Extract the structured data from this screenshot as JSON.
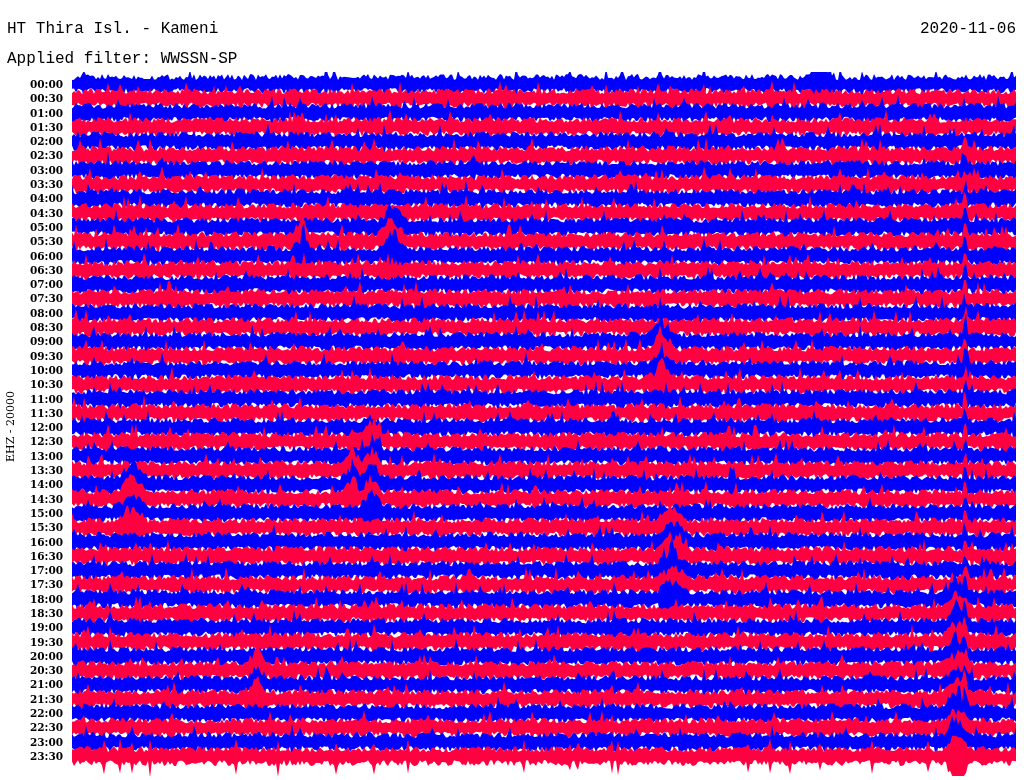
{
  "header": {
    "station": "HT Thira Isl. - Kameni",
    "date": "2020-11-06",
    "filter": "Applied filter: WWSSN-SP"
  },
  "axis_label": "EHZ - 20000",
  "rows": [
    {
      "time": "00:00",
      "color": "#0000ff"
    },
    {
      "time": "00:30",
      "color": "#ff0040"
    },
    {
      "time": "01:00",
      "color": "#0000ff"
    },
    {
      "time": "01:30",
      "color": "#ff0040"
    },
    {
      "time": "02:00",
      "color": "#0000ff"
    },
    {
      "time": "02:30",
      "color": "#ff0040"
    },
    {
      "time": "03:00",
      "color": "#0000ff"
    },
    {
      "time": "03:30",
      "color": "#ff0040"
    },
    {
      "time": "04:00",
      "color": "#0000ff"
    },
    {
      "time": "04:30",
      "color": "#ff0040"
    },
    {
      "time": "05:00",
      "color": "#0000ff"
    },
    {
      "time": "05:30",
      "color": "#ff0040"
    },
    {
      "time": "06:00",
      "color": "#0000ff"
    },
    {
      "time": "06:30",
      "color": "#ff0040"
    },
    {
      "time": "07:00",
      "color": "#0000ff"
    },
    {
      "time": "07:30",
      "color": "#ff0040"
    },
    {
      "time": "08:00",
      "color": "#0000ff"
    },
    {
      "time": "08:30",
      "color": "#ff0040"
    },
    {
      "time": "09:00",
      "color": "#0000ff"
    },
    {
      "time": "09:30",
      "color": "#ff0040"
    },
    {
      "time": "10:00",
      "color": "#0000ff"
    },
    {
      "time": "10:30",
      "color": "#ff0040"
    },
    {
      "time": "11:00",
      "color": "#0000ff"
    },
    {
      "time": "11:30",
      "color": "#ff0040"
    },
    {
      "time": "12:00",
      "color": "#0000ff"
    },
    {
      "time": "12:30",
      "color": "#ff0040"
    },
    {
      "time": "13:00",
      "color": "#0000ff"
    },
    {
      "time": "13:30",
      "color": "#ff0040"
    },
    {
      "time": "14:00",
      "color": "#0000ff"
    },
    {
      "time": "14:30",
      "color": "#ff0040"
    },
    {
      "time": "15:00",
      "color": "#0000ff"
    },
    {
      "time": "15:30",
      "color": "#ff0040"
    },
    {
      "time": "16:00",
      "color": "#0000ff"
    },
    {
      "time": "16:30",
      "color": "#ff0040"
    },
    {
      "time": "17:00",
      "color": "#0000ff"
    },
    {
      "time": "17:30",
      "color": "#ff0040"
    },
    {
      "time": "18:00",
      "color": "#0000ff"
    },
    {
      "time": "18:30",
      "color": "#ff0040"
    },
    {
      "time": "19:00",
      "color": "#0000ff"
    },
    {
      "time": "19:30",
      "color": "#ff0040"
    },
    {
      "time": "20:00",
      "color": "#0000ff"
    },
    {
      "time": "20:30",
      "color": "#ff0040"
    },
    {
      "time": "21:00",
      "color": "#0000ff"
    },
    {
      "time": "21:30",
      "color": "#ff0040"
    },
    {
      "time": "22:00",
      "color": "#0000ff"
    },
    {
      "time": "22:30",
      "color": "#ff0040"
    },
    {
      "time": "23:00",
      "color": "#0000ff"
    },
    {
      "time": "23:30",
      "color": "#ff0040"
    }
  ]
}
